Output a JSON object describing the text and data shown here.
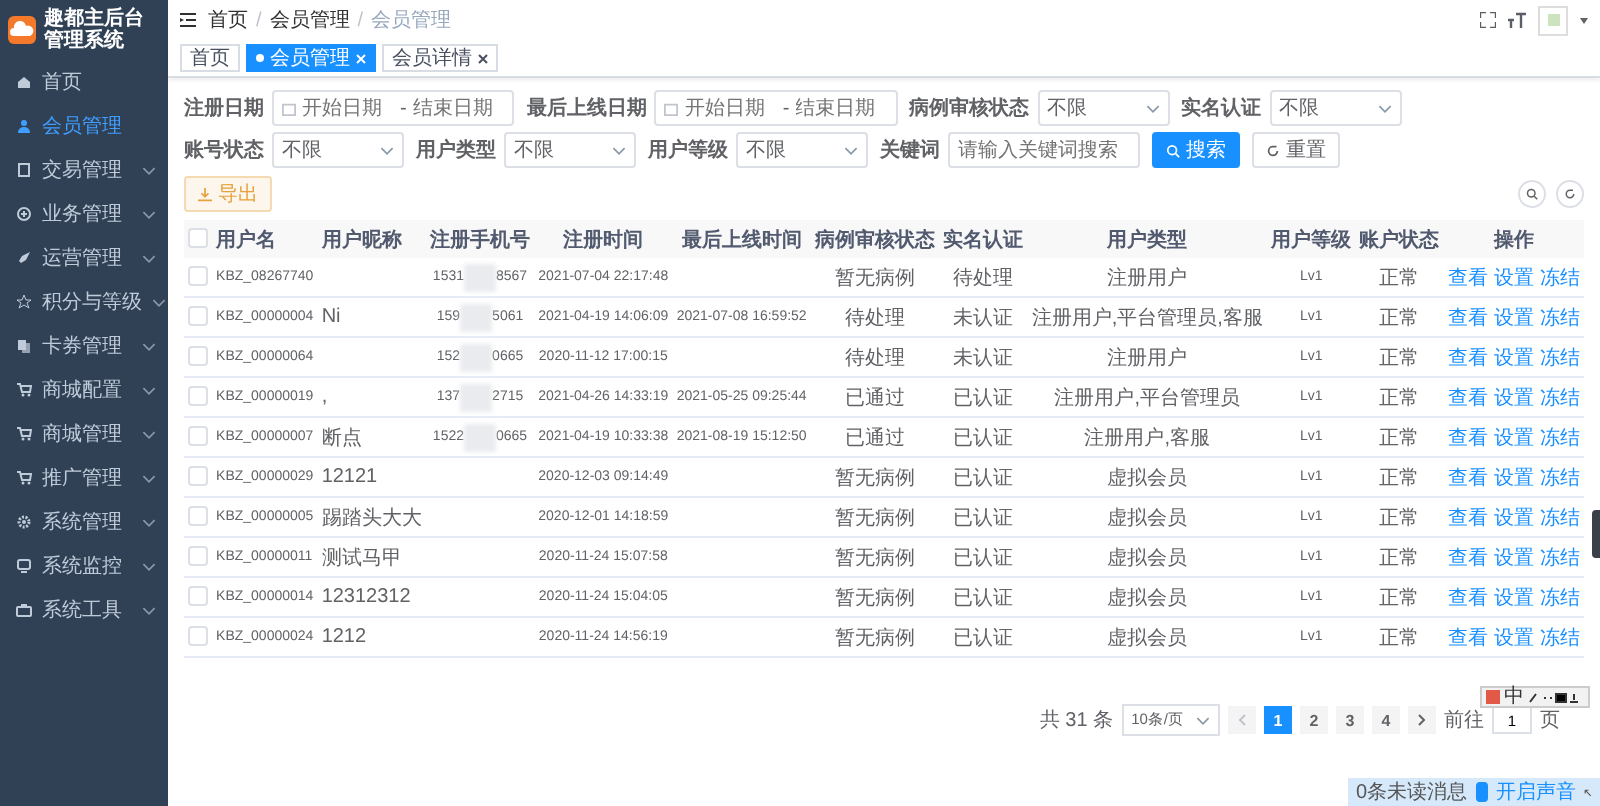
{
  "sidebar": {
    "title": "趣都主后台管理系统",
    "items": [
      {
        "label": "首页",
        "selected": false,
        "has_submenu": false
      },
      {
        "label": "会员管理",
        "selected": true,
        "has_submenu": false
      },
      {
        "label": "交易管理",
        "selected": false,
        "has_submenu": true
      },
      {
        "label": "业务管理",
        "selected": false,
        "has_submenu": true
      },
      {
        "label": "运营管理",
        "selected": false,
        "has_submenu": true
      },
      {
        "label": "积分与等级",
        "selected": false,
        "has_submenu": true
      },
      {
        "label": "卡券管理",
        "selected": false,
        "has_submenu": true
      },
      {
        "label": "商城配置",
        "selected": false,
        "has_submenu": true
      },
      {
        "label": "商城管理",
        "selected": false,
        "has_submenu": true
      },
      {
        "label": "推广管理",
        "selected": false,
        "has_submenu": true
      },
      {
        "label": "系统管理",
        "selected": false,
        "has_submenu": true
      },
      {
        "label": "系统监控",
        "selected": false,
        "has_submenu": true
      },
      {
        "label": "系统工具",
        "selected": false,
        "has_submenu": true
      }
    ]
  },
  "breadcrumb": [
    "首页",
    "会员管理",
    "会员管理"
  ],
  "breadcrumb_separator": "/",
  "tags": [
    {
      "label": "首页",
      "selected": false,
      "closable": false
    },
    {
      "label": "会员管理",
      "selected": true,
      "closable": true
    },
    {
      "label": "会员详情",
      "selected": false,
      "closable": true
    }
  ],
  "filters": [
    {
      "kind": "daterange",
      "label": "注册日期",
      "start_placeholder": "开始日期",
      "separator": "-",
      "end_placeholder": "结束日期"
    },
    {
      "kind": "daterange",
      "label": "最后上线日期",
      "start_placeholder": "开始日期",
      "separator": "-",
      "end_placeholder": "结束日期"
    },
    {
      "kind": "select",
      "label": "病例审核状态",
      "value": "不限"
    },
    {
      "kind": "select",
      "label": "实名认证",
      "value": "不限"
    },
    {
      "kind": "select",
      "label": "账号状态",
      "value": "不限"
    },
    {
      "kind": "select",
      "label": "用户类型",
      "value": "不限"
    },
    {
      "kind": "select",
      "label": "用户等级",
      "value": "不限"
    },
    {
      "kind": "text",
      "label": "关键词",
      "placeholder": "请输入关键词搜索"
    }
  ],
  "search_button": "搜索",
  "reset_button": "重置",
  "export_button": "导出",
  "table": {
    "select_all_checked": false,
    "columns": [
      "用户名",
      "用户昵称",
      "注册手机号",
      "注册时间",
      "最后上线时间",
      "病例审核状态",
      "实名认证",
      "用户类型",
      "用户等级",
      "账户状态",
      "操作"
    ],
    "rows": [
      {
        "selected": false,
        "username": "KBZ_08267740",
        "nickname": "",
        "phone_start": "1531",
        "phone_end": "8567",
        "registered": "2021-07-04 22:17:48",
        "last_online": "",
        "case_status": "暂无病例",
        "verification": "待处理",
        "user_type": "注册用户",
        "level": "Lv1",
        "status": "正常",
        "actions": [
          "查看",
          "设置",
          "冻结"
        ]
      },
      {
        "selected": false,
        "username": "KBZ_00000004",
        "nickname": "Ni",
        "phone_start": "159",
        "phone_end": "5061",
        "registered": "2021-04-19 14:06:09",
        "last_online": "2021-07-08 16:59:52",
        "case_status": "待处理",
        "verification": "未认证",
        "user_type": "注册用户,平台管理员,客服",
        "level": "Lv1",
        "status": "正常",
        "actions": [
          "查看",
          "设置",
          "冻结"
        ]
      },
      {
        "selected": false,
        "username": "KBZ_00000064",
        "nickname": "",
        "phone_start": "152",
        "phone_end": "0665",
        "registered": "2020-11-12 17:00:15",
        "last_online": "",
        "case_status": "待处理",
        "verification": "未认证",
        "user_type": "注册用户",
        "level": "Lv1",
        "status": "正常",
        "actions": [
          "查看",
          "设置",
          "冻结"
        ]
      },
      {
        "selected": false,
        "username": "KBZ_00000019",
        "nickname": ",",
        "phone_start": "137",
        "phone_end": "2715",
        "registered": "2021-04-26 14:33:19",
        "last_online": "2021-05-25 09:25:44",
        "case_status": "已通过",
        "verification": "已认证",
        "user_type": "注册用户,平台管理员",
        "level": "Lv1",
        "status": "正常",
        "actions": [
          "查看",
          "设置",
          "冻结"
        ]
      },
      {
        "selected": false,
        "username": "KBZ_00000007",
        "nickname": "断点",
        "phone_start": "1522",
        "phone_end": "0665",
        "registered": "2021-04-19 10:33:38",
        "last_online": "2021-08-19 15:12:50",
        "case_status": "已通过",
        "verification": "已认证",
        "user_type": "注册用户,客服",
        "level": "Lv1",
        "status": "正常",
        "actions": [
          "查看",
          "设置",
          "冻结"
        ]
      },
      {
        "selected": false,
        "username": "KBZ_00000029",
        "nickname": "12121",
        "phone_start": "",
        "phone_end": "",
        "registered": "2020-12-03 09:14:49",
        "last_online": "",
        "case_status": "暂无病例",
        "verification": "已认证",
        "user_type": "虚拟会员",
        "level": "Lv1",
        "status": "正常",
        "actions": [
          "查看",
          "设置",
          "冻结"
        ]
      },
      {
        "selected": false,
        "username": "KBZ_00000005",
        "nickname": "踢踏头大大",
        "phone_start": "",
        "phone_end": "",
        "registered": "2020-12-01 14:18:59",
        "last_online": "",
        "case_status": "暂无病例",
        "verification": "已认证",
        "user_type": "虚拟会员",
        "level": "Lv1",
        "status": "正常",
        "actions": [
          "查看",
          "设置",
          "冻结"
        ]
      },
      {
        "selected": false,
        "username": "KBZ_00000011",
        "nickname": "测试马甲",
        "phone_start": "",
        "phone_end": "",
        "registered": "2020-11-24 15:07:58",
        "last_online": "",
        "case_status": "暂无病例",
        "verification": "已认证",
        "user_type": "虚拟会员",
        "level": "Lv1",
        "status": "正常",
        "actions": [
          "查看",
          "设置",
          "冻结"
        ]
      },
      {
        "selected": false,
        "username": "KBZ_00000014",
        "nickname": "12312312",
        "phone_start": "",
        "phone_end": "",
        "registered": "2020-11-24 15:04:05",
        "last_online": "",
        "case_status": "暂无病例",
        "verification": "已认证",
        "user_type": "虚拟会员",
        "level": "Lv1",
        "status": "正常",
        "actions": [
          "查看",
          "设置",
          "冻结"
        ]
      },
      {
        "selected": false,
        "username": "KBZ_00000024",
        "nickname": "1212",
        "phone_start": "",
        "phone_end": "",
        "registered": "2020-11-24 14:56:19",
        "last_online": "",
        "case_status": "暂无病例",
        "verification": "已认证",
        "user_type": "虚拟会员",
        "level": "Lv1",
        "status": "正常",
        "actions": [
          "查看",
          "设置",
          "冻结"
        ]
      }
    ]
  },
  "pagination": {
    "total": "共 31 条",
    "page_size": "10条/页",
    "pages": [
      {
        "label": "1",
        "selected": true
      },
      {
        "label": "2",
        "selected": false
      },
      {
        "label": "3",
        "selected": false
      },
      {
        "label": "4",
        "selected": false
      }
    ],
    "goto_label": "前往",
    "goto_value": "1",
    "goto_suffix": "页"
  },
  "ime_toolbar": {
    "mode": "中"
  },
  "notice_bar": {
    "message": "0条未读消息",
    "sound_checked": true,
    "sound_label": "开启声音"
  }
}
